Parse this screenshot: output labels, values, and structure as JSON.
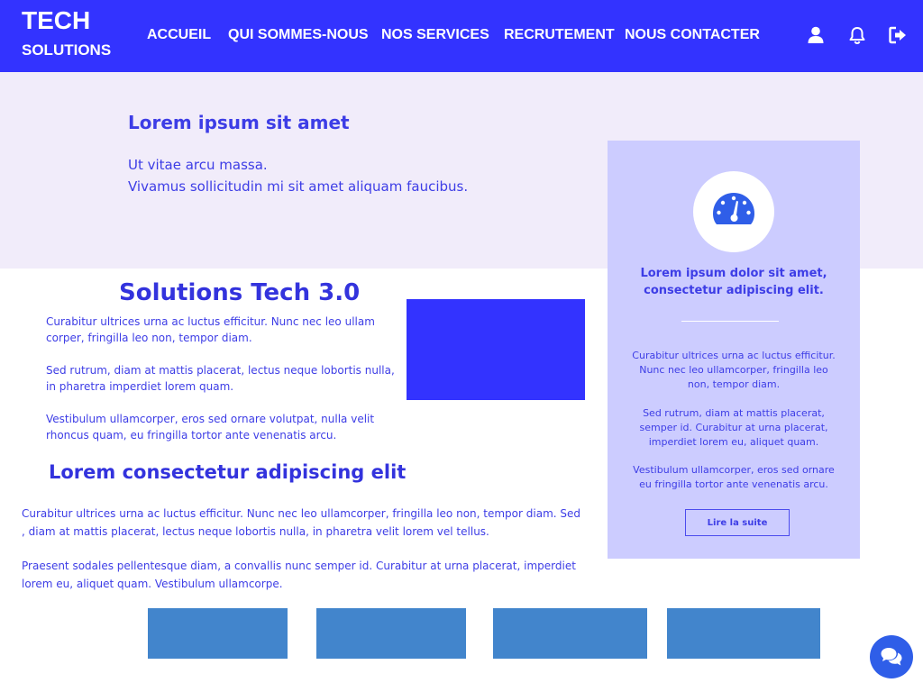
{
  "header": {
    "logo_top": "TECH",
    "logo_bottom": "SOLUTIONS",
    "nav": [
      "ACCUEIL",
      "QUI SOMMES-NOUS",
      "NOS SERVICES",
      "RECRUTEMENT",
      "NOUS CONTACTER"
    ],
    "icons": [
      "user-icon",
      "bell-icon",
      "logout-icon"
    ]
  },
  "hero": {
    "title": "Lorem ipsum sit amet",
    "lines": [
      "Ut vitae arcu massa.",
      "Vivamus sollicitudin mi sit amet aliquam faucibus."
    ]
  },
  "card": {
    "icon": "speedometer-icon",
    "heading": "Lorem ipsum dolor sit amet, consectetur adipiscing elit.",
    "paragraphs": [
      "Curabitur ultrices urna ac luctus efficitur. Nunc nec leo ullamcorper, fringilla leo non, tempor diam.",
      "Sed rutrum, diam at mattis placerat, semper id. Curabitur at urna placerat, imperdiet lorem eu, aliquet quam.",
      "Vestibulum ullamcorper, eros sed ornare eu fringilla tortor ante venenatis arcu."
    ],
    "button_label": "Lire la suite"
  },
  "main": {
    "title": "Solutions Tech 3.0",
    "paragraphs": [
      "Curabitur ultrices urna ac luctus efficitur. Nunc nec leo ullam corper, fringilla leo non, tempor diam.",
      "Sed rutrum, diam at mattis placerat, lectus neque lobortis nulla, in pharetra  imperdiet lorem quam.",
      "Vestibulum ullamcorper, eros sed ornare volutpat, nulla velit rhoncus quam, eu fringilla tortor ante venenatis arcu."
    ],
    "subtitle": "Lorem consectetur adipiscing elit",
    "long_paragraphs": [
      "Curabitur ultrices urna ac luctus efficitur. Nunc nec leo ullamcorper, fringilla leo non, tempor diam. Sed , diam at mattis placerat, lectus neque lobortis nulla, in pharetra velit lorem vel tellus.",
      "Praesent sodales pellentesque diam, a convallis nunc semper id. Curabitur at urna placerat, imperdiet lorem eu, aliquet quam. Vestibulum ullamcorpe."
    ]
  },
  "chat": {
    "icon": "chat-icon"
  },
  "colors": {
    "header_bg": "#3333ff",
    "hero_bg": "#f1ecfa",
    "card_bg": "#ccccff",
    "text_accent": "#3d3de6",
    "tile_bg": "#4285cc",
    "chat_bg": "#2f5ee8"
  }
}
